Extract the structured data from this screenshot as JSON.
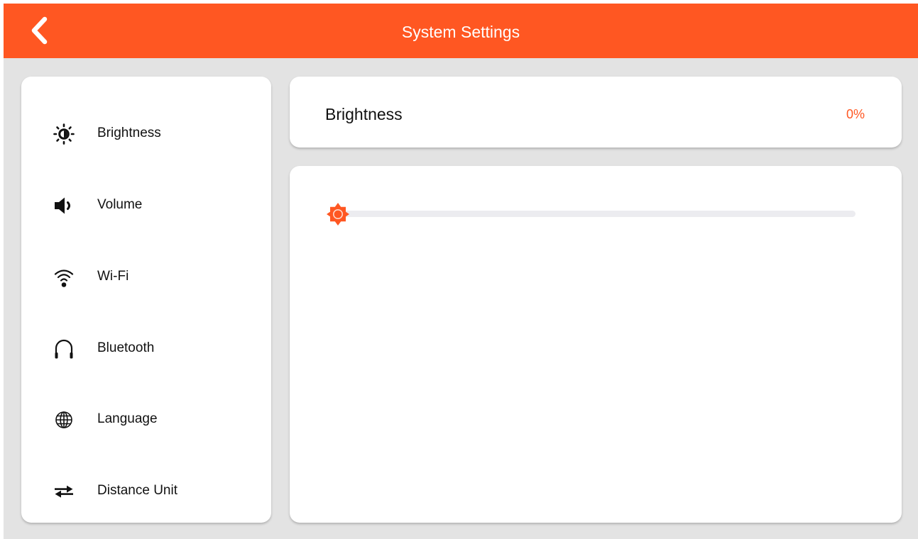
{
  "app_bar": {
    "title": "System Settings",
    "back_icon": "chevron-left-icon"
  },
  "sidebar": {
    "items": [
      {
        "label": "Brightness",
        "icon": "brightness-icon"
      },
      {
        "label": "Volume",
        "icon": "speaker-icon"
      },
      {
        "label": "Wi-Fi",
        "icon": "wifi-icon"
      },
      {
        "label": "Bluetooth",
        "icon": "headphones-icon"
      },
      {
        "label": "Language",
        "icon": "globe-icon"
      },
      {
        "label": "Distance Unit",
        "icon": "swap-arrows-icon"
      }
    ]
  },
  "detail": {
    "title": "Brightness",
    "value_text": "0%",
    "slider": {
      "value": 0,
      "min": 0,
      "max": 100,
      "thumb_icon": "sun-icon"
    }
  },
  "colors": {
    "accent": "#ff5722",
    "background": "#e3e3e3",
    "card": "#ffffff",
    "track": "#ececf0",
    "text": "#111111"
  }
}
